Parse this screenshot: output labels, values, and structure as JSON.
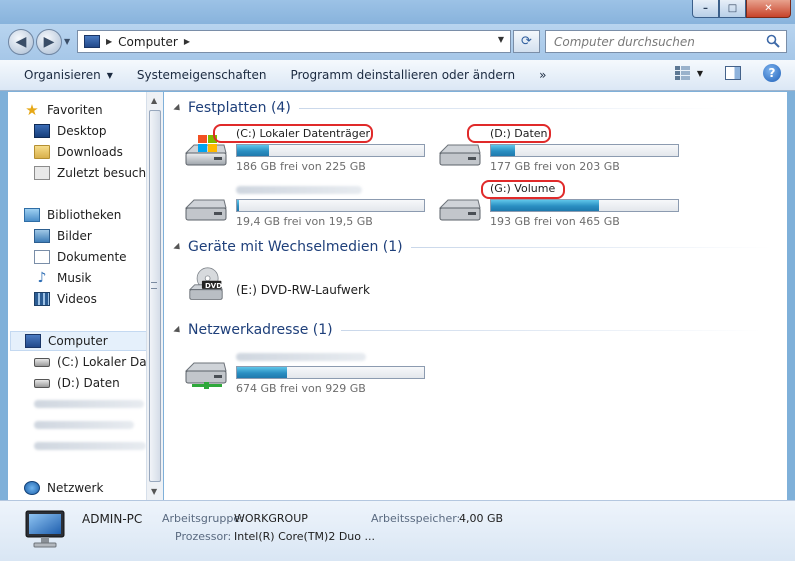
{
  "window": {
    "buttons": {
      "minimize": "–",
      "maximize": "□",
      "close": "✕"
    }
  },
  "address": {
    "crumb": "Computer",
    "search_placeholder": "Computer durchsuchen"
  },
  "toolbar": {
    "items": [
      "Organisieren",
      "Systemeigenschaften",
      "Programm deinstallieren oder ändern",
      "»"
    ]
  },
  "sidebar": {
    "favorites": {
      "label": "Favoriten",
      "items": [
        "Desktop",
        "Downloads",
        "Zuletzt besucht"
      ]
    },
    "libraries": {
      "label": "Bibliotheken",
      "items": [
        "Bilder",
        "Dokumente",
        "Musik",
        "Videos"
      ]
    },
    "computer": {
      "label": "Computer",
      "items": [
        "(C:) Lokaler Datenträger",
        "(D:) Daten"
      ]
    },
    "network": {
      "label": "Netzwerk"
    }
  },
  "sections": {
    "hdd": "Festplatten (4)",
    "removable": "Geräte mit Wechselmedien (1)",
    "network": "Netzwerkadresse (1)"
  },
  "drives": [
    {
      "name": "(C:) Lokaler Datenträger",
      "free": "186 GB frei von 225 GB",
      "used_fraction": 0.17,
      "highlighted": true
    },
    {
      "name": "(D:) Daten",
      "free": "177 GB frei von 203 GB",
      "used_fraction": 0.13,
      "highlighted": true
    },
    {
      "name": "",
      "free": "19,4 GB frei von 19,5 GB",
      "used_fraction": 0.01,
      "highlighted": false,
      "blurred_name": true
    },
    {
      "name": "(G:) Volume",
      "free": "193 GB frei von 465 GB",
      "used_fraction": 0.58,
      "highlighted": true
    }
  ],
  "removable": {
    "name": "(E:) DVD-RW-Laufwerk",
    "badge": "DVD"
  },
  "network_drive": {
    "free": "674 GB frei von 929 GB",
    "used_fraction": 0.27
  },
  "details": {
    "pc_name": "ADMIN-PC",
    "workgroup_label": "Arbeitsgruppe:",
    "workgroup": "WORKGROUP",
    "memory_label": "Arbeitsspeicher:",
    "memory": "4,00 GB",
    "cpu_label": "Prozessor:",
    "cpu": "Intel(R) Core(TM)2 Duo ..."
  },
  "colors": {
    "highlight": "#e02a2a",
    "bar_fill": "#2a8fc2"
  }
}
